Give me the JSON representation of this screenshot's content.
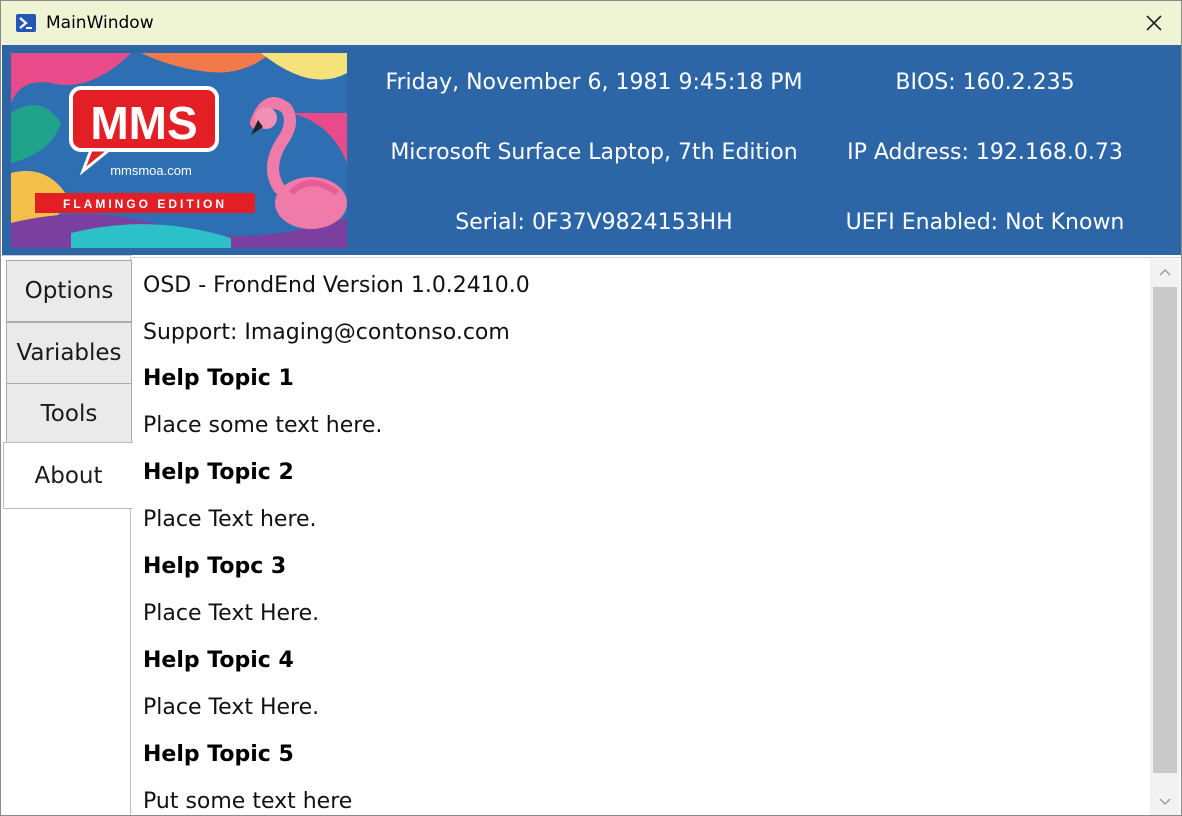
{
  "window": {
    "title": "MainWindow",
    "icons": {
      "app": "powershell-icon",
      "close": "close-icon"
    }
  },
  "banner": {
    "logo_text": "MMS",
    "site": "mmsmoa.com",
    "edition": "FLAMINGO EDITION",
    "colors": {
      "brand_red": "#e31e24",
      "background": "#2e6fb3"
    }
  },
  "header": {
    "background": "#2d66a6",
    "datetime": "Friday, November 6, 1981 9:45:18 PM",
    "device_model": "Microsoft Surface Laptop, 7th Edition",
    "serial": "Serial: 0F37V9824153HH",
    "bios": "BIOS: 160.2.235",
    "ip_address": "IP Address: 192.168.0.73",
    "uefi": "UEFI Enabled: Not Known"
  },
  "tabs": [
    {
      "label": "Options",
      "selected": false
    },
    {
      "label": "Variables",
      "selected": false
    },
    {
      "label": "Tools",
      "selected": false
    },
    {
      "label": "About",
      "selected": true
    }
  ],
  "about": {
    "version": "OSD - FrondEnd Version 1.0.2410.0",
    "support": "Support: Imaging@contonso.com",
    "topics": [
      {
        "heading": "Help Topic 1",
        "text": "Place some text here."
      },
      {
        "heading": "Help Topic 2",
        "text": "Place Text here."
      },
      {
        "heading": "Help Topc 3",
        "text": "Place Text Here."
      },
      {
        "heading": "Help Topic 4",
        "text": "Place Text Here."
      },
      {
        "heading": "Help Topic 5",
        "text": "Put some text here"
      }
    ]
  }
}
